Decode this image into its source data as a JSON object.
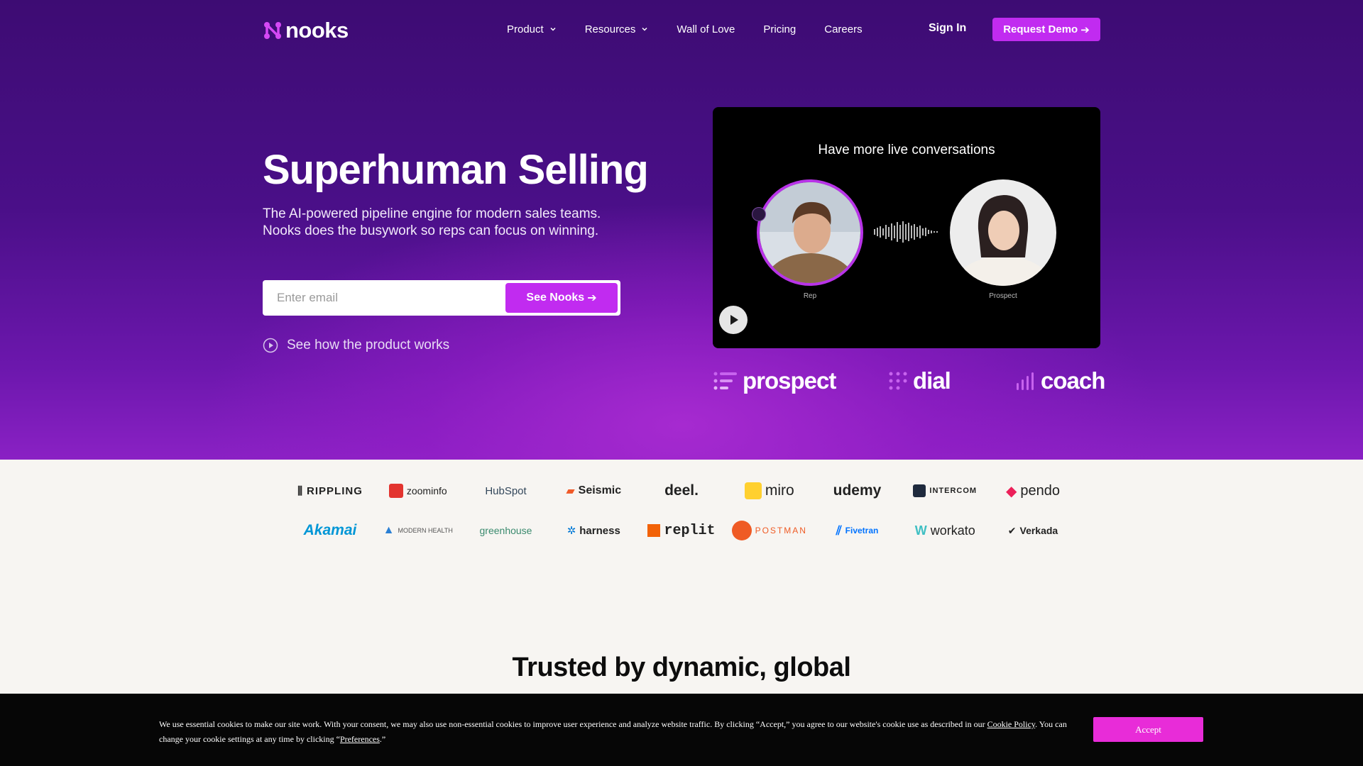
{
  "brand": {
    "name": "nooks"
  },
  "nav": {
    "items": [
      {
        "label": "Product",
        "has_dropdown": true
      },
      {
        "label": "Resources",
        "has_dropdown": true
      },
      {
        "label": "Wall of Love",
        "has_dropdown": false
      },
      {
        "label": "Pricing",
        "has_dropdown": false
      },
      {
        "label": "Careers",
        "has_dropdown": false
      }
    ],
    "sign_in": "Sign In",
    "request_demo": "Request Demo"
  },
  "hero": {
    "title": "Superhuman Selling",
    "subtitle": "The AI-powered pipeline engine for modern sales teams. Nooks does the busywork so reps can focus on winning.",
    "email_placeholder": "Enter email",
    "email_value": "",
    "cta": "See Nooks",
    "secondary_cta": "See how the product works"
  },
  "video": {
    "title": "Have more live conversations",
    "rep_label": "Rep",
    "prospect_label": "Prospect",
    "play_icon": "play-icon"
  },
  "products": [
    "prospect",
    "dial",
    "coach"
  ],
  "customer_logos": {
    "row1": [
      "RIPPLING",
      "zoominfo",
      "HubSpot",
      "Seismic",
      "deel.",
      "miro",
      "udemy",
      "INTERCOM",
      "pendo"
    ],
    "row2": [
      "Akamai",
      "MODERN HEALTH",
      "greenhouse",
      "harness",
      "replit",
      "POSTMAN",
      "Fivetran",
      "workato",
      "Verkada"
    ]
  },
  "trusted": {
    "heading": "Trusted by dynamic, global"
  },
  "cookie": {
    "text_part1": "We use essential cookies to make our site work. With your consent, we may also use non-essential cookies to improve user experience and analyze website traffic. By clicking “Accept,” you agree to our website's cookie use as described in our ",
    "policy_link": "Cookie Policy",
    "text_part2": ". You can change your cookie settings at any time by clicking “",
    "preferences_link": "Preferences",
    "text_part3": ".”",
    "accept": "Accept"
  },
  "colors": {
    "accent": "#c12bf0",
    "hero_bg": "#4a0f88",
    "accept_button": "#e82cd8"
  }
}
